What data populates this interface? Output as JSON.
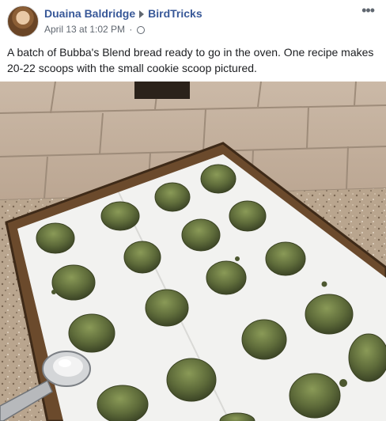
{
  "post": {
    "author": "Duaina Baldridge",
    "group": "BirdTricks",
    "timestamp": "April 13 at 1:02 PM",
    "separator": "·",
    "more_label": "•••",
    "text": "A batch of Bubba's Blend bread ready to go in the oven. One recipe makes 20-22 scoops with the small cookie scoop pictured."
  },
  "icons": {
    "avatar": "profile-avatar",
    "privacy": "globe-icon",
    "share_arrow": "triangle-right-icon",
    "more": "more-options-icon"
  },
  "colors": {
    "link": "#385898",
    "meta": "#606770",
    "text": "#1c1e21",
    "dough": "#5e6b3a",
    "pan": "#6b4a2c",
    "parchment": "#f2f2f0",
    "granite": "#b9a58e"
  }
}
